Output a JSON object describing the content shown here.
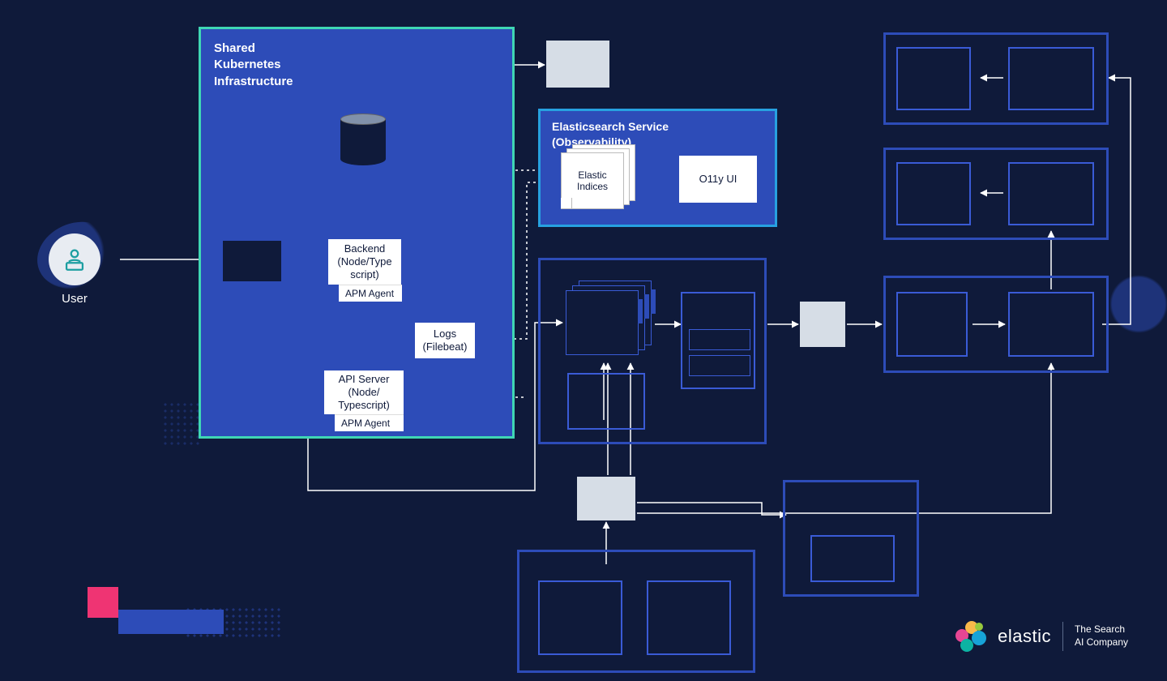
{
  "user": {
    "label": "User"
  },
  "k8s": {
    "title": "Shared\nKubernetes\nInfrastructure",
    "backend": {
      "label": "Backend\n(Node/Type\nscript)",
      "apm": "APM Agent"
    },
    "api": {
      "label": "API Server\n(Node/\nTypescript)",
      "apm": "APM Agent"
    },
    "logs": {
      "label": "Logs\n(Filebeat)"
    }
  },
  "es": {
    "title": "Elasticsearch Service\n(Observability)",
    "indices": "Elastic\nIndices",
    "ui": "O11y UI"
  },
  "branding": {
    "name": "elastic",
    "tagline": "The Search\nAI Company"
  }
}
